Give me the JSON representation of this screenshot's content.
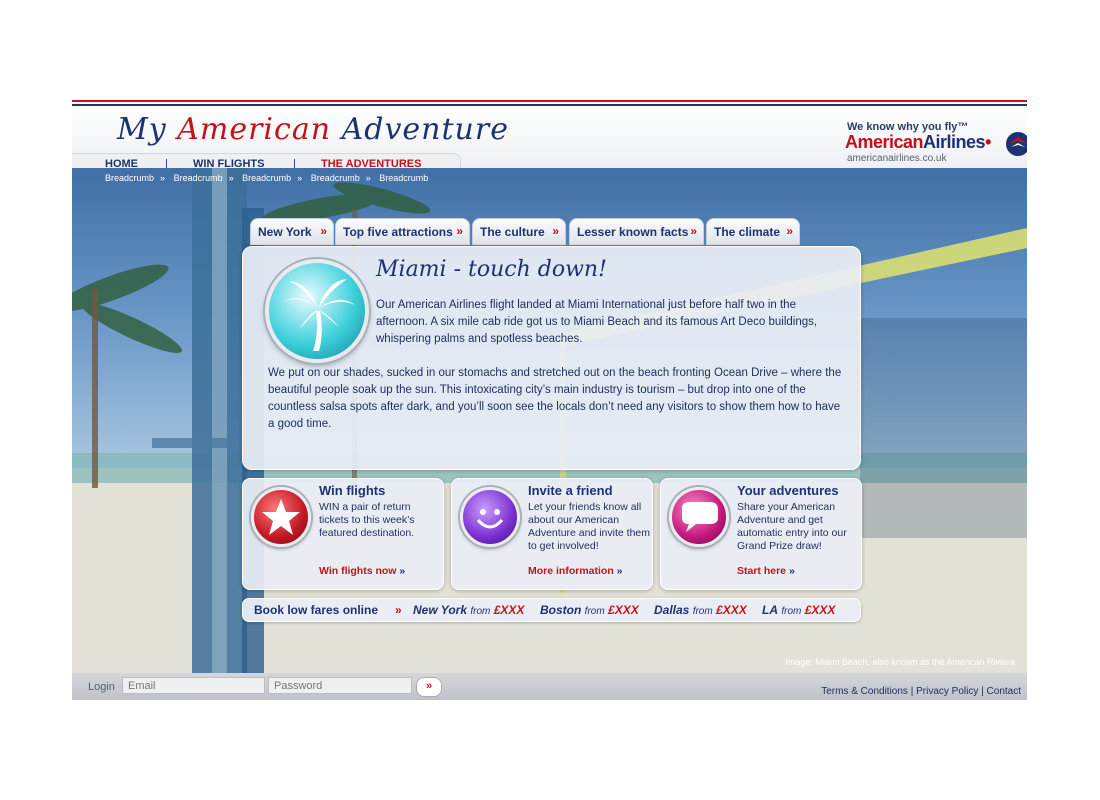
{
  "header": {
    "logo": {
      "w1": "My",
      "w2": "American",
      "w3": "Adventure"
    },
    "nav": {
      "home": "HOME",
      "win_flights": "WIN FLIGHTS",
      "adventures": "THE ADVENTURES",
      "separator": "|"
    },
    "brand": {
      "tagline": "We know why you fly™",
      "name_part1": "American",
      "name_part2": "Airlines",
      "mark": "•",
      "url": "americanairlines.co.uk"
    }
  },
  "breadcrumbs": [
    "Breadcrumb",
    "Breadcrumb",
    "Breadcrumb",
    "Breadcrumb",
    "Breadcrumb"
  ],
  "breadcrumb_separator": "»",
  "tabs": [
    {
      "label": "New York"
    },
    {
      "label": "Top five attractions"
    },
    {
      "label": "The culture"
    },
    {
      "label": "Lesser known facts"
    },
    {
      "label": "The climate"
    }
  ],
  "tab_arrow": "»",
  "article": {
    "title": "Miami - touch down!",
    "para1": "Our American Airlines flight landed at Miami International just before half two in the afternoon. A six mile cab ride got us to Miami Beach and its famous Art Deco buildings, whispering palms and spotless beaches.",
    "para2": "We put on our shades, sucked in our stomachs and stretched out on the beach fronting Ocean Drive – where the beautiful people soak up the sun. This intoxicating city’s main industry is tourism – but drop into one of the countless salsa spots after dark, and you’ll soon see the locals don’t need any visitors to show them how to have a good time.",
    "icon": "palm-tree-icon"
  },
  "cards": [
    {
      "title": "Win flights",
      "text": "WIN a pair of return tickets to this week’s featured destination.",
      "link": "Win flights now",
      "icon": "star-icon",
      "color": "#c01822"
    },
    {
      "title": "Invite a friend",
      "text": "Let your friends know all about our American Adventure and invite them to get involved!",
      "link": "More information",
      "icon": "smiley-icon",
      "color": "#7a2fd0"
    },
    {
      "title": "Your adventures",
      "text": "Share your American Adventure and get automatic entry into our Grand Prize draw!",
      "link": "Start here",
      "icon": "speech-bubble-icon",
      "color": "#c0187a"
    }
  ],
  "booking": {
    "label": "Book low fares online",
    "arrow": "»",
    "from": "from",
    "fares": [
      {
        "city": "New York",
        "price": "£XXX"
      },
      {
        "city": "Boston",
        "price": "£XXX"
      },
      {
        "city": "Dallas",
        "price": "£XXX"
      },
      {
        "city": "LA",
        "price": "£XXX"
      }
    ]
  },
  "image_caption": "Image: Miami Beach, also known as the American Riviera",
  "footer": {
    "login_label": "Login",
    "email_placeholder": "Email",
    "password_placeholder": "Password",
    "go": "»",
    "terms": "Terms & Conditions",
    "privacy": "Privacy Policy",
    "contact": "Contact",
    "sep": "|"
  },
  "colors": {
    "brand_blue": "#1d3273",
    "brand_red": "#c4111a"
  }
}
